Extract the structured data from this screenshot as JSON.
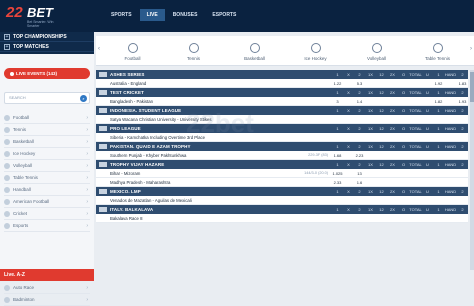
{
  "brand": {
    "num": "22",
    "word": "BET",
    "tag": "Bet Smarter. Win Smarter"
  },
  "nav": [
    "SPORTS",
    "LIVE",
    "BONUSES",
    "ESPORTS"
  ],
  "sidebar": {
    "top_championships": "TOP CHAMPIONSHIPS",
    "top_matches": "TOP MATCHES",
    "live_events": "LIVE EVENTS (143)",
    "search_placeholder": "SEARCH",
    "sports": [
      "Football",
      "Tennis",
      "Basketball",
      "Ice Hockey",
      "Volleyball",
      "Table Tennis",
      "Handball",
      "American Football",
      "Cricket",
      "Esports"
    ],
    "live_az": "Live. A-Z",
    "extra": [
      "Auto Race",
      "Badminton"
    ]
  },
  "sportbar": [
    "Football",
    "Tennis",
    "Basketball",
    "Ice Hockey",
    "Volleyball",
    "Table Tennis"
  ],
  "odds_headers": [
    "1",
    "X",
    "2",
    "1X",
    "12",
    "2X",
    "O",
    "TOTAL",
    "U",
    "1",
    "HAND",
    "2"
  ],
  "groups": [
    {
      "name": "ASHES SERIES",
      "rows": [
        {
          "team": "Australia - England",
          "score": "",
          "odds": [
            "1.22",
            "",
            "5.3",
            "",
            "",
            "",
            "",
            "",
            "",
            "1.92",
            "",
            "1.83"
          ]
        }
      ]
    },
    {
      "name": "TEST CRICKET",
      "rows": [
        {
          "team": "Bangladesh - Pakistan",
          "score": "",
          "odds": [
            "3",
            "",
            "1.4",
            "",
            "",
            "",
            "",
            "",
            "",
            "1.82",
            "",
            "1.93"
          ]
        }
      ]
    },
    {
      "name": "INDONESIA. STUDENT LEAGUE",
      "rows": [
        {
          "team": "Satya Wacana Christian University - University Stikes",
          "score": "",
          "odds": [
            "",
            "",
            "",
            "",
            "",
            "",
            "",
            "",
            "",
            "",
            "",
            ""
          ]
        }
      ]
    },
    {
      "name": "PRO LEAGUE",
      "rows": [
        {
          "team": "Siberia - Kamchatka Including Overtime 3rd Place",
          "score": "",
          "odds": [
            "",
            "",
            "",
            "",
            "",
            "",
            "",
            "",
            "",
            "",
            "",
            ""
          ]
        }
      ]
    },
    {
      "name": "PAKISTAN. QUAID E AZAM TROPHY",
      "rows": [
        {
          "team": "Southern Punjab - Khyber Pakhtunkhwa",
          "score": "229-3F (83)",
          "odds": [
            "1.68",
            "",
            "2.23",
            "",
            "",
            "",
            "",
            "",
            "",
            "",
            "",
            ""
          ]
        }
      ]
    },
    {
      "name": "TROPHY VIJAY HAZARE",
      "rows": [
        {
          "team": "Bihar - Mizoram",
          "score": "144/3-0 (20.0)",
          "odds": [
            "1.025",
            "",
            "13",
            "",
            "",
            "",
            "",
            "",
            "",
            "",
            "",
            ""
          ]
        },
        {
          "team": "Madhya Pradesh - Maharashtra",
          "score": "",
          "odds": [
            "2.33",
            "",
            "1.6",
            "",
            "",
            "",
            "",
            "",
            "",
            "",
            "",
            ""
          ]
        }
      ]
    },
    {
      "name": "MEXICO. LMP",
      "rows": [
        {
          "team": "Venados de Mazatlan - Aguilas de Mexicali",
          "score": "",
          "odds": [
            "",
            "",
            "",
            "",
            "",
            "",
            "",
            "",
            "",
            "",
            "",
            ""
          ]
        }
      ]
    },
    {
      "name": "ITALY. BALKALAVA",
      "rows": [
        {
          "team": "Bakalava Race 8",
          "score": "",
          "odds": [
            "",
            "",
            "",
            "",
            "",
            "",
            "",
            "",
            "",
            "",
            "",
            ""
          ]
        }
      ]
    }
  ],
  "watermark": "22bet"
}
